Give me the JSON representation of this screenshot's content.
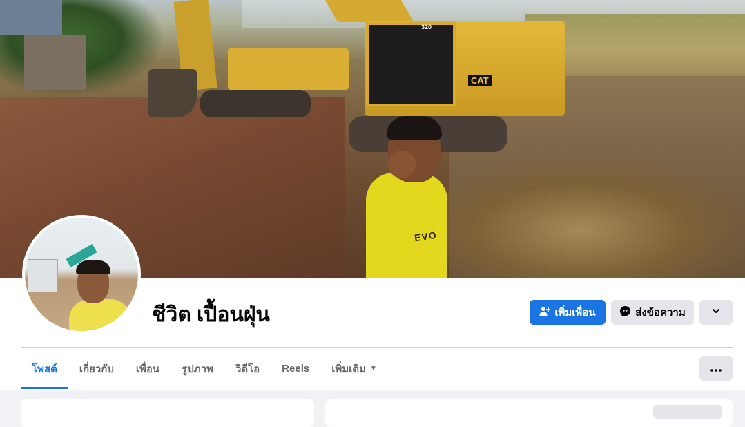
{
  "cover": {
    "excavator_brand": "CAT",
    "excavator_model": "320",
    "shirt_sponsor": "EVO"
  },
  "profile": {
    "name": "ชีวิต เปื้อนฝุ่น"
  },
  "actions": {
    "add_friend": "เพิ่มเพื่อน",
    "message": "ส่งข้อความ"
  },
  "tabs": [
    {
      "label": "โพสต์",
      "active": true
    },
    {
      "label": "เกี่ยวกับ"
    },
    {
      "label": "เพื่อน"
    },
    {
      "label": "รูปภาพ"
    },
    {
      "label": "วิดีโอ"
    },
    {
      "label": "Reels"
    },
    {
      "label": "เพิ่มเติม"
    }
  ],
  "colors": {
    "accent": "#1b74e4",
    "button_gray": "#e4e6eb",
    "page_bg": "#f0f2f5"
  }
}
